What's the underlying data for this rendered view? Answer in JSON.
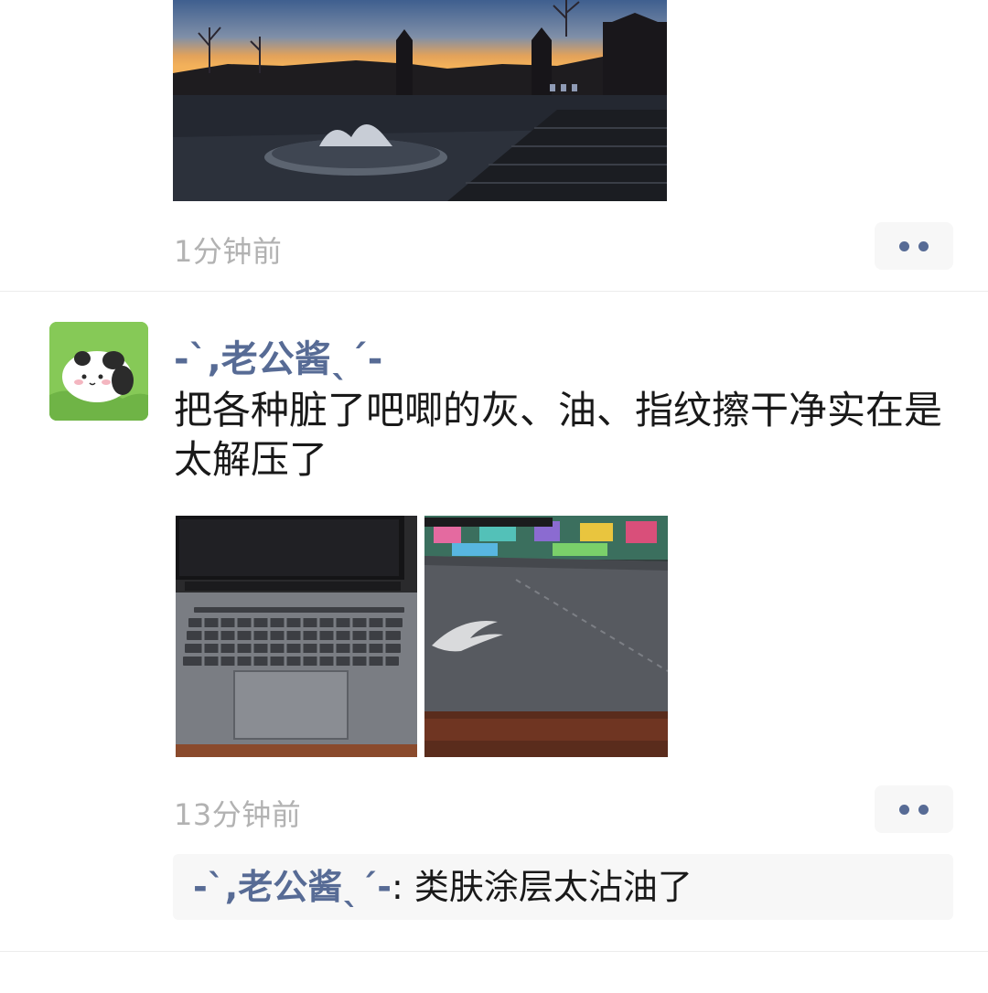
{
  "posts": [
    {
      "photos": [
        {
          "name": "sunset-courtyard-photo"
        }
      ],
      "time": "1分钟前"
    },
    {
      "author": "-ˋ,老公酱ˎˊ-",
      "text": "把各种脏了吧唧的灰、油、指纹擦干净实在是太解压了",
      "photos": [
        {
          "name": "laptop-keyboard-photo"
        },
        {
          "name": "laptop-lid-photo"
        }
      ],
      "time": "13分钟前",
      "comments": [
        {
          "author": "-ˋ,老公酱ˎˊ-",
          "separator": ": ",
          "text": "类肤涂层太沾油了"
        }
      ]
    }
  ],
  "colors": {
    "link": "#576b95",
    "time": "#b2b2b2",
    "text": "#191919",
    "panel": "#f7f7f7"
  },
  "icons": {
    "more": "two-dots-icon"
  }
}
